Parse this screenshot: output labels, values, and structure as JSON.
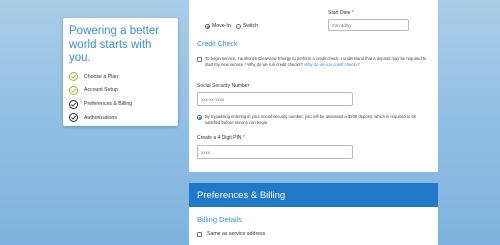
{
  "sidebar": {
    "title": "Powering a better world starts with you.",
    "steps": [
      {
        "label": "Choose a Plan",
        "status": "done"
      },
      {
        "label": "Account Setup",
        "status": "done"
      },
      {
        "label": "Preferences & Billing",
        "status": "pending"
      },
      {
        "label": "Authorizations",
        "status": "pending"
      }
    ]
  },
  "form": {
    "move_type": {
      "options": [
        "Move-In",
        "Switch"
      ],
      "selected": "Move-In"
    },
    "start_date": {
      "label": "Start Date",
      "required_mark": "*",
      "placeholder": "mm/dd/yy"
    },
    "credit_check": {
      "title": "Credit Check",
      "consent_text": "To begin service, I authorize Clearview Energy to perform a credit check. I understand that a deposit may be required to start my new service.* Why do we run credit checks?",
      "consent_link": "Why do we run credit checks?",
      "ssn_label": "Social Security Number",
      "ssn_placeholder": "xxx-xx-xxxx",
      "bypass_text": "By bypassing entering in your social security number, you will be assessed a $200 deposit, which is required to be satisfied before service can begin.",
      "pin_label": "Create a 4 Digit PIN",
      "pin_required_mark": "*",
      "pin_placeholder": "xxxx"
    }
  },
  "billing": {
    "header": "Preferences & Billing",
    "details_title": "Billing Details",
    "same_as_service": "Same as service address"
  },
  "colors": {
    "accent": "#3a8fd1",
    "header_bg": "#1f78c8",
    "step_done": "#a4b83c"
  }
}
